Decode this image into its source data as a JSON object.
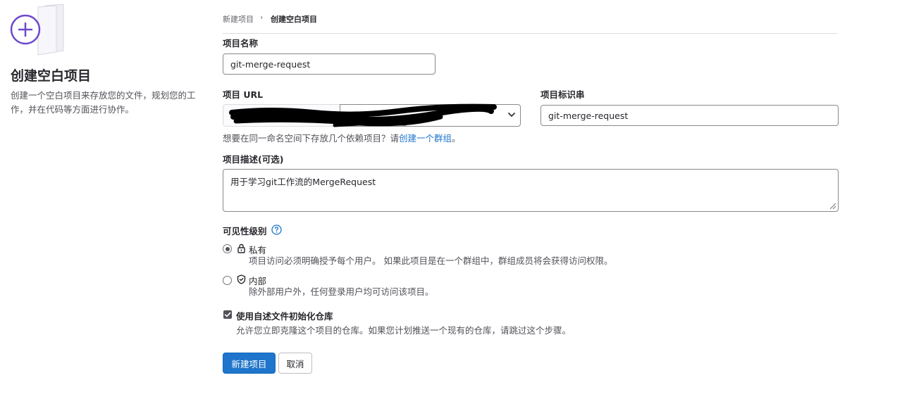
{
  "left_panel": {
    "title": "创建空白项目",
    "description": "创建一个空白项目来存放您的文件，规划您的工作，并在代码等方面进行协作。",
    "illustration_icon": "plus-circle-document-icon"
  },
  "breadcrumb": {
    "parent": "新建项目",
    "separator": "›",
    "current": "创建空白项目"
  },
  "form": {
    "project_name": {
      "label": "项目名称",
      "value": "git-merge-request"
    },
    "project_url": {
      "label": "项目 URL",
      "redacted": true
    },
    "project_slug": {
      "label": "项目标识串",
      "value": "git-merge-request"
    },
    "namespace_hint": {
      "text": "想要在同一命名空间下存放几个依赖项目？请",
      "link": "创建一个群组",
      "suffix": "。"
    },
    "description": {
      "label": "项目描述(可选)",
      "value": "用于学习git工作流的MergeRequest"
    },
    "visibility": {
      "label": "可见性级别",
      "options": [
        {
          "label": "私有",
          "help": "项目访问必须明确授予每个用户。 如果此项目是在一个群组中，群组成员将会获得访问权限。",
          "icon": "lock-icon",
          "checked": true
        },
        {
          "label": "内部",
          "help": "除外部用户外，任何登录用户均可访问该项目。",
          "icon": "shield-icon",
          "checked": false
        }
      ]
    },
    "readme": {
      "label": "使用自述文件初始化仓库",
      "help": "允许您立即克隆这个项目的仓库。如果您计划推送一个现有的仓库，请跳过这个步骤。",
      "checked": true
    }
  },
  "actions": {
    "create": "新建项目",
    "cancel": "取消"
  },
  "colors": {
    "primary": "#1f75cb",
    "accent_purple": "#6e49cb",
    "link": "#1f75cb"
  }
}
